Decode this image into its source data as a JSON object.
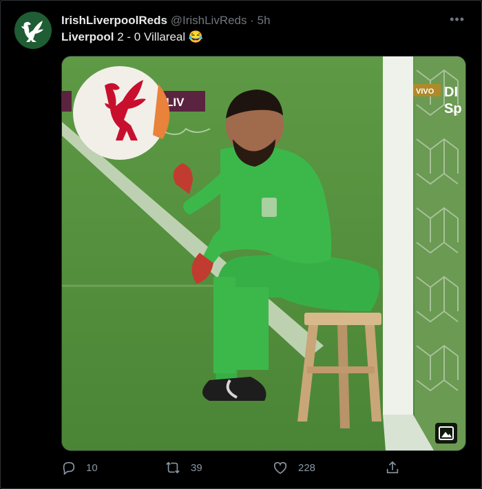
{
  "tweet": {
    "display_name": "IrishLiverpoolReds",
    "handle": "@IrishLivReds",
    "separator": "·",
    "time": "5h",
    "more_label": "•••",
    "text_team": "Liverpool",
    "text_rest": " 2 - 0 Villareal ",
    "emoji": "😂"
  },
  "media": {
    "scoreboard_abbr": "LIV",
    "sponsor_text": "VIVO",
    "board_text_top": "DI",
    "board_text_bottom": "Sp"
  },
  "actions": {
    "reply_count": "10",
    "retweet_count": "39",
    "like_count": "228"
  },
  "colors": {
    "background": "#000000",
    "pitch": "#4f8b3a",
    "kit": "#3cb84a",
    "crest_red": "#c8102e",
    "muted": "#71767b"
  }
}
